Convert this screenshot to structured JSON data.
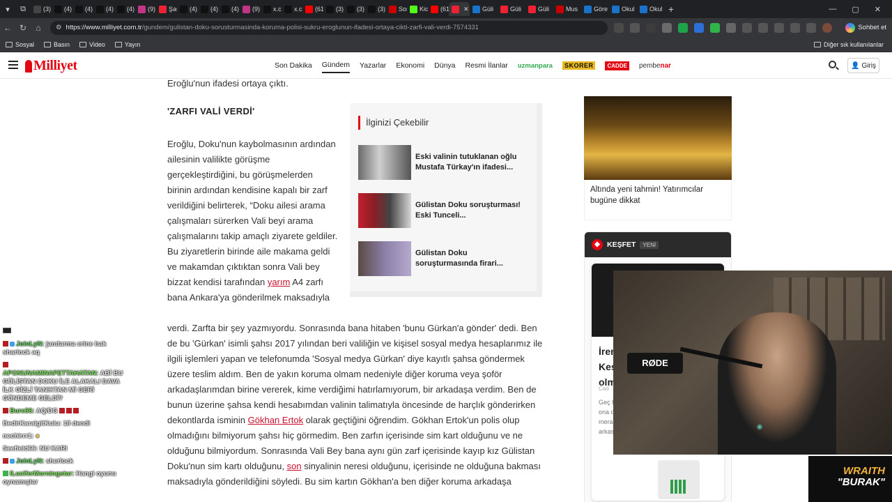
{
  "browser": {
    "tabs": [
      "(3) B",
      "(4) X",
      "(4) X",
      "(4) X",
      "(4) X",
      "(9) In",
      "Şaşk",
      "(4) X",
      "(4) g",
      "(4) X",
      "(9) In",
      "x.com",
      "x.co",
      "(616)",
      "(3) X",
      "(3) X",
      "(3) X",
      "Son",
      "Kick",
      "(616)",
      "",
      "Güli",
      "Güli",
      "Güli",
      "Mus",
      "Göre",
      "Okul",
      "Okul"
    ],
    "url_domain": "https://www.milliyet.com.tr",
    "url_path": "/gundem/gulistan-doku-sorusturmasinda-koruma-polisi-sukru-eroglunun-ifadesi-ortaya-cikti-zarfi-vali-verdi-7574331",
    "chat_button": "Sohbet et",
    "bookmarks": [
      "Sosyal",
      "Basın",
      "Video",
      "Yayın"
    ],
    "bookmarks_other": "Diğer sık kullanılanlar"
  },
  "site": {
    "logo": "Milliyet",
    "nav": [
      "Son Dakika",
      "Gündem",
      "Yazarlar",
      "Ekonomi",
      "Dünya",
      "Resmi İlanlar"
    ],
    "brands": {
      "uzmanpara": "uzmanpara",
      "skorer": "SKORER",
      "cadde": "CADDE",
      "pembenar_a": "pembe",
      "pembenar_b": "nar"
    },
    "login": "Giriş"
  },
  "article": {
    "lede": "Eroğlu'nun ifadesi ortaya çıktı.",
    "subheading": "'ZARFI VALİ VERDİ'",
    "para1_a": "Eroğlu, Doku'nun kaybolmasının ardından ailesinin valilikte görüşme gerçekleştirdiğini, bu görüşmelerden birinin ardından kendisine kapalı bir zarf verildiğini belirterek, “Doku ailesi arama çalışmaları sürerken Vali beyi arama çalışmalarını takip amaçlı ziyarete geldiler. Bu ziyaretlerin birinde aile makama geldi ve makamdan çıktıktan sonra Vali bey bizzat kendisi tarafından",
    "para1_link": "yarım",
    "para1_b": "A4 zarfı bana Ankara'ya gönderilmek maksadıyla",
    "para3_a": "verdi. Zarfta bir şey yazmıyordu. Sonrasında bana hitaben 'bunu Gürkan'a gönder' dedi. Ben de bu 'Gürkan' isimli şahsı 2017 yılından beri valiliğin ve kişisel sosyal medya hesaplarımız ile ilgili işlemleri yapan ve telefonumda 'Sosyal medya Gürkan' diye kayıtlı şahsa göndermek üzere teslim aldım. Ben de yakın koruma olmam nedeniyle diğer koruma veya şoför arkadaşlarımdan birine vererek, kime verdiğimi hatırlamıyorum, bir arkadaşa verdim. Ben de bunun üzerine şahsa kendi hesabımdan valinin talimatıyla öncesinde de harçlık gönderirken dekontlarda isminin",
    "para3_link": "Gökhan Ertok",
    "para3_b": "olarak geçtiğini öğrendim. Gökhan Ertok'un polis olup olmadığını bilmiyorum şahsı hiç görmedim. Ben zarfın içerisinde sim kart olduğunu ve ne olduğunu bilmiyordum. Sonrasında Vali Bey bana aynı gün zarf içerisinde kayıp kız Gülistan Doku'nun sim kartı olduğunu,",
    "para3_link2": "son",
    "para3_c": "sinyalinin neresi olduğunu, içerisinde ne olduğuna bakması maksadıyla gönderildiğini söyledi. Bu sim kartın Gökhan'a ben diğer koruma arkadaşa"
  },
  "related": {
    "title": "İlginizi Çekebilir",
    "items": [
      {
        "text": "Eski valinin tutuklanan oğlu Mustafa Türkay'ın ifadesi..."
      },
      {
        "text": "Gülistan Doku soruşturması! Eski Tunceli..."
      },
      {
        "text": "Gülistan Doku soruşturmasında firari..."
      }
    ]
  },
  "sidebar": {
    "gold_caption": "Altında yeni tahmin! Yatırımcılar bugüne dikkat",
    "kesfet": "KEŞFET",
    "yeni": "YENİ",
    "card_title": "İren Kes olm",
    "card_source": "Cad",
    "card_body": "Geç hay oyu med pay hen galasında. İşte ona oyuncunun hayranlarını meraklandıran o paylaşımın perde arkası..."
  },
  "chat": [
    {
      "user": "JoinLyN:",
      "msg": "jandarma erine bak sharlock aq",
      "color": "green"
    },
    {
      "user": "APONUNAMINAFETTAHATAN:",
      "msg": "ABİ BU GÜLİSTAN DOKU İLE ALAKALI DAVA İLK GİZLİ TANIKTAN Mİ GERİ GÜNDEME GELDİ?",
      "color": "green"
    },
    {
      "user": "Bure36:",
      "msg": "AQ/DG",
      "color": "green"
    },
    {
      "user": "BedirKaraigitKulu:",
      "msg": "18 dendi",
      "color": "white"
    },
    {
      "user": "nechirrr1:",
      "msg": "",
      "color": "white"
    },
    {
      "user": "Seefield66:",
      "msg": "NU KARI",
      "color": "white"
    },
    {
      "user": "JoinLyN:",
      "msg": "sherlock",
      "color": "green"
    },
    {
      "user": "ILuciferMorningstar:",
      "msg": "Hangi oyunu oynamışlar",
      "color": "green"
    }
  ],
  "overlay": {
    "mic_label": "RØDE",
    "wraith_a": "WRAITH",
    "wraith_b": "\"BURAK\""
  },
  "colors": {
    "brand_red": "#e30613",
    "link_red": "#c8102e",
    "chrome_dark": "#202124"
  }
}
